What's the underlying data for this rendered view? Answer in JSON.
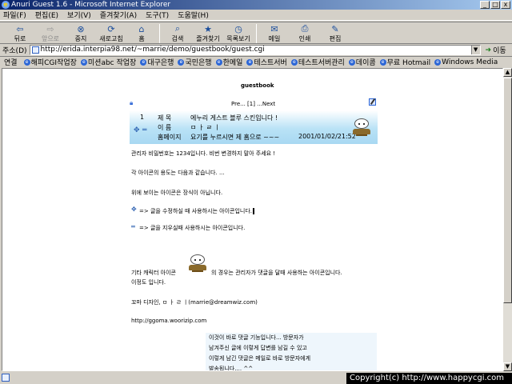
{
  "window": {
    "title": "Anuri Guest 1.6 - Microsoft Internet Explorer",
    "controls": [
      "_",
      "□",
      "x"
    ]
  },
  "menu": [
    "파일(F)",
    "편집(E)",
    "보기(V)",
    "즐겨찾기(A)",
    "도구(T)",
    "도움말(H)"
  ],
  "toolbar": {
    "back": "뒤로",
    "forward": "앞으로",
    "stop": "중지",
    "refresh": "새로고침",
    "home": "홈",
    "search": "검색",
    "favorites": "즐겨찾기",
    "history": "목록보기",
    "mail": "메일",
    "print": "인쇄",
    "edit": "편집"
  },
  "address": {
    "label": "주소(D)",
    "url": "http://erida.interpia98.net/~marrie/demo/guestbook/guest.cgi",
    "go": "이동"
  },
  "links": {
    "label": "연결",
    "items": [
      "해피CGI작업장",
      "미션abc 작업장",
      "대구은행",
      "국민은행",
      "한메일",
      "테스트서버",
      "테스트서버관리",
      "데이콤",
      "무료 Hotmail",
      "Windows Media"
    ]
  },
  "page": {
    "title": "guestbook",
    "pager": "Pre... [1] ...Next",
    "entry": {
      "number": "1",
      "subject_label": "제    목",
      "subject": "에누리 게스트 블루 스킨입니다 !",
      "name_label": "이    름",
      "name": "ㅁ ㅏ ㄹ ㅣ",
      "homepage_label": "홈페이지",
      "homepage": "요기를 누르시면 제 홈으로 ~~~",
      "date": "2001/01/02/21:52",
      "edit_symbol": "✥",
      "delete_symbol": "═"
    },
    "body": [
      "관리자 비밀번호는 1234입니다. 비번 변경하지 말아 주세요 !",
      "각 아이콘의 용도는 다음과 같습니다. ...",
      "위에 보이는 아이콘은 장식이 아닙니다.",
      "=> 글을 수정하실 때 사용하시는 아이콘입니다.",
      "=> 글을 지우실때 사용하시는 아이콘입니다.",
      "기타 캐릭터 아이콘",
      "의 경우는 관리자가 댓글을 달때 사용하는 아이콘입니다.",
      "이정도 입니다.",
      "꼬마 디자인,  ㅁ ㅏ ㄹ ㅣ(marrie@dreamwiz.com)",
      "http://ggoma.woorizip.com"
    ],
    "reply": [
      "이것이 바로 댓글 기능입니다... 방문자가",
      "남겨주신 글에 이렇게 답변를 남길 수 있고",
      "이렇게 남긴 댓글은 메일로 바로 방문자에게",
      "발송됩니다.... ^^"
    ]
  },
  "status": {
    "copyright": "Copyright(c) http://www.happycgi.com"
  }
}
